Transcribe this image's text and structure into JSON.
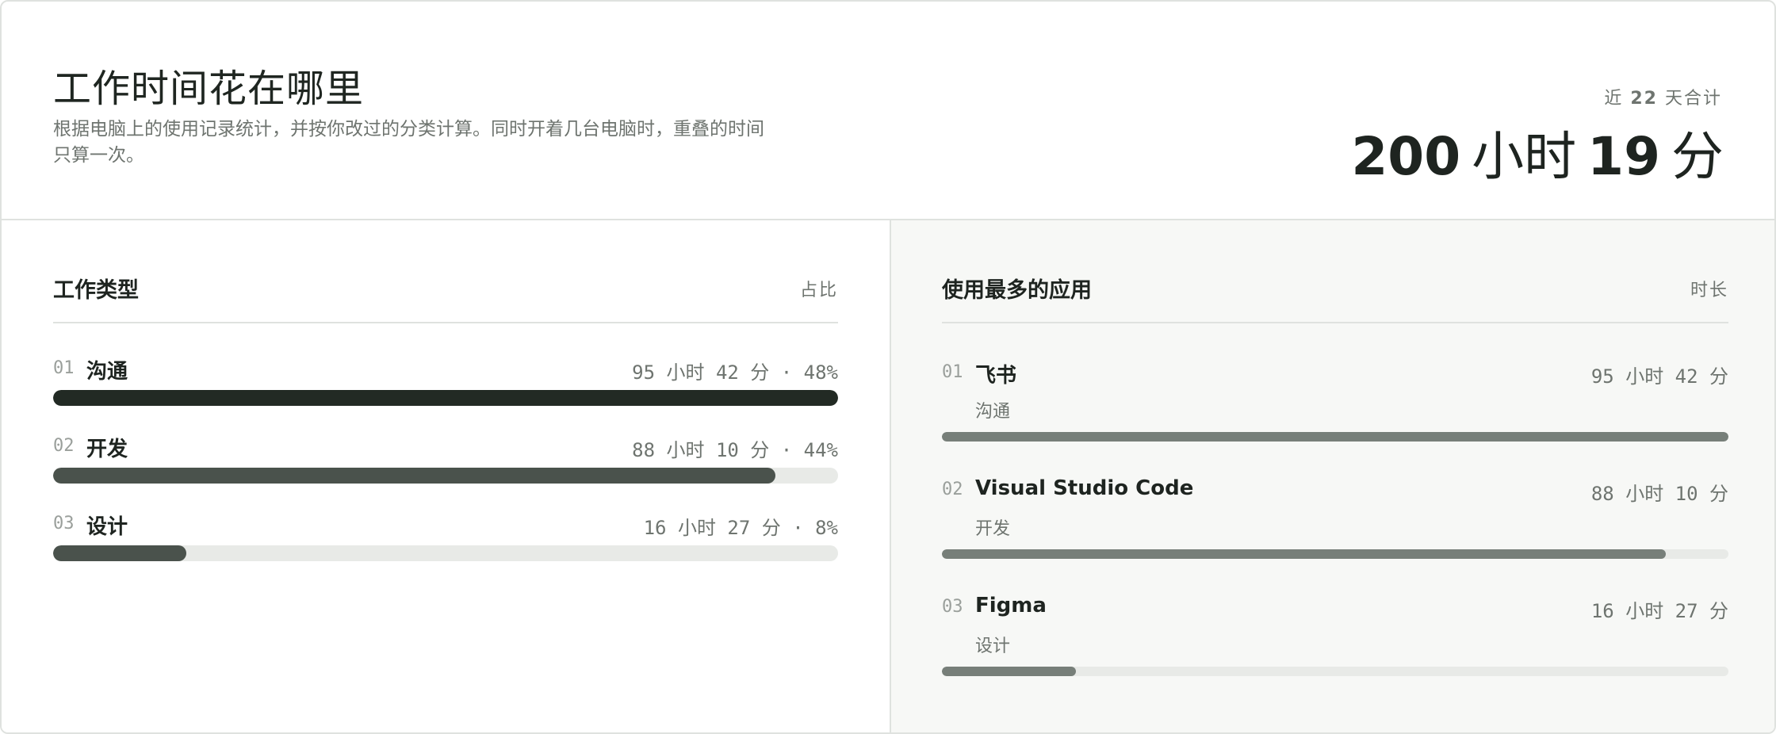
{
  "header": {
    "title": "工作时间花在哪里",
    "subtitle": "根据电脑上的使用记录统计，并按你改过的分类计算。同时开着几台电脑时，重叠的时间只算一次。",
    "total_label_prefix": "近",
    "total_label_days": "22",
    "total_label_suffix": "天合计",
    "total_hours": "200",
    "total_hours_unit": "小时",
    "total_minutes": "19",
    "total_minutes_unit": "分"
  },
  "work_types": {
    "title": "工作类型",
    "right_label": "占比",
    "items": [
      {
        "index": "01",
        "name": "沟通",
        "meta": "95 小时 42 分 · 48%",
        "percent": 100,
        "color": "#222a24"
      },
      {
        "index": "02",
        "name": "开发",
        "meta": "88 小时 10 分 · 44%",
        "percent": 92,
        "color": "#4a524c"
      },
      {
        "index": "03",
        "name": "设计",
        "meta": "16 小时 27 分 · 8%",
        "percent": 17,
        "color": "#4a524c"
      }
    ]
  },
  "top_apps": {
    "title": "使用最多的应用",
    "right_label": "时长",
    "items": [
      {
        "index": "01",
        "name": "飞书",
        "category": "沟通",
        "meta": "95 小时 42 分",
        "percent": 100
      },
      {
        "index": "02",
        "name": "Visual Studio Code",
        "category": "开发",
        "meta": "88 小时 10 分",
        "percent": 92
      },
      {
        "index": "03",
        "name": "Figma",
        "category": "设计",
        "meta": "16 小时 27 分",
        "percent": 17
      }
    ]
  }
}
